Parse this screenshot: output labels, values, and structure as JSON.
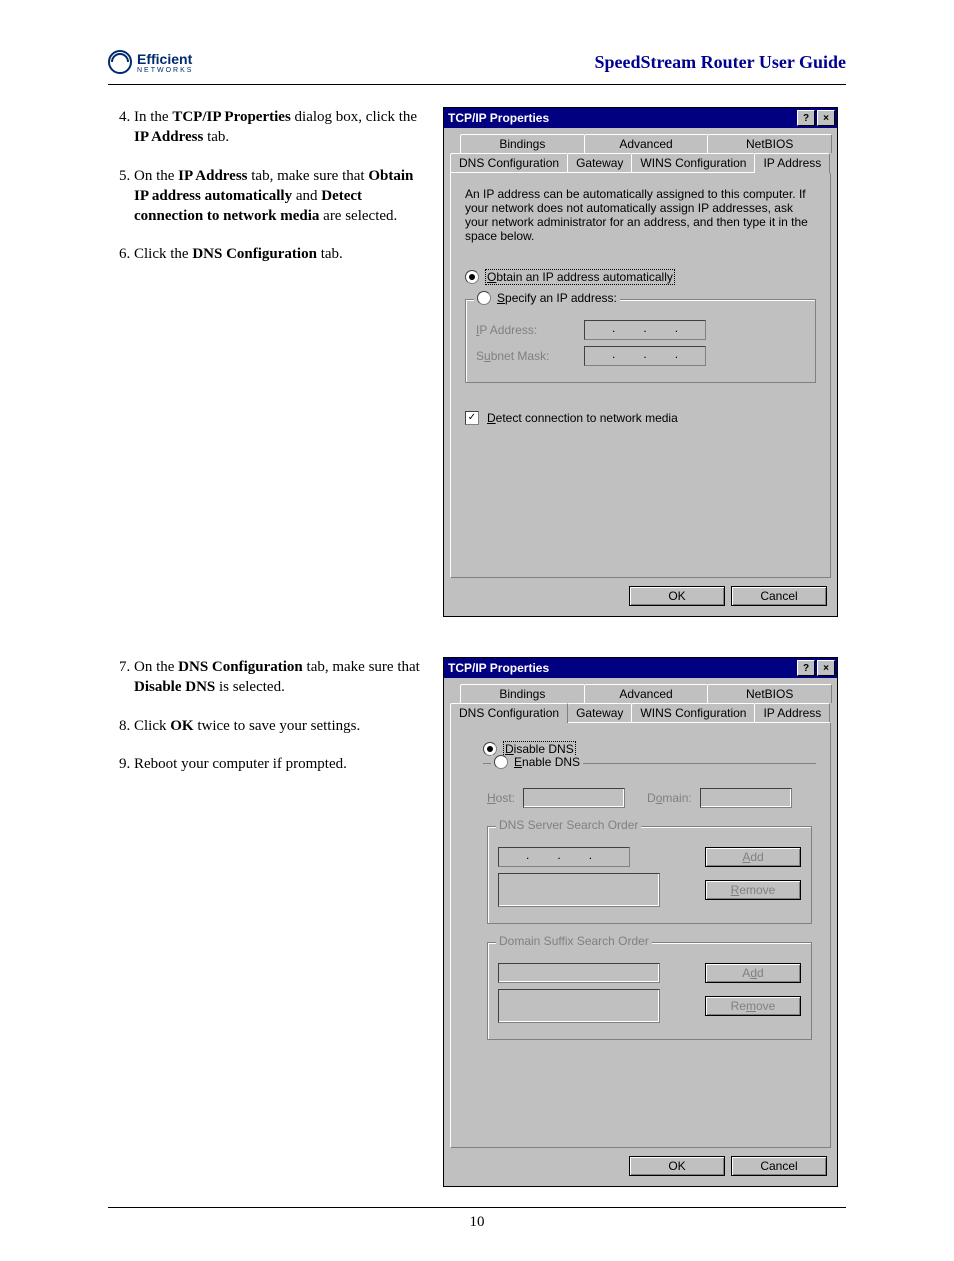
{
  "header": {
    "brand": "Efficient",
    "brand_sub": "NETWORKS",
    "guide_title": "SpeedStream Router User Guide"
  },
  "section1": {
    "steps": {
      "s4": {
        "pre": "In the ",
        "b1": "TCP/IP Properties",
        "mid": " dialog box, click the ",
        "b2": "IP Address",
        "post": " tab."
      },
      "s5": {
        "pre": "On the ",
        "b1": "IP Address",
        "mid1": " tab, make sure that ",
        "b2": "Obtain IP address automatically",
        "mid2": " and ",
        "b3": "Detect connection to network media",
        "post": " are selected."
      },
      "s6": {
        "pre": "Click the ",
        "b1": "DNS Configuration",
        "post": " tab."
      }
    },
    "dialog": {
      "title": "TCP/IP Properties",
      "tabs_back": [
        "Bindings",
        "Advanced",
        "NetBIOS"
      ],
      "tabs_front": [
        "DNS Configuration",
        "Gateway",
        "WINS Configuration",
        "IP Address"
      ],
      "active_tab": "IP Address",
      "body_text": "An IP address can be automatically assigned to this computer. If your network does not automatically assign IP addresses, ask your network administrator for an address, and then type it in the space below.",
      "radio_obtain": "Obtain an IP address automatically",
      "radio_obtain_ul": "O",
      "radio_specify": "Specify an IP address:",
      "radio_specify_ul": "S",
      "ip_label": "IP Address:",
      "ip_label_ul": "I",
      "subnet_label": "Subnet Mask:",
      "subnet_label_ul": "u",
      "detect": "Detect connection to network media",
      "detect_ul": "D",
      "ok": "OK",
      "cancel": "Cancel"
    }
  },
  "section2": {
    "steps": {
      "s7": {
        "pre": "On the ",
        "b1": "DNS Configuration",
        "mid": " tab, make sure that ",
        "b2": "Disable DNS",
        "post": " is selected."
      },
      "s8": {
        "pre": "Click ",
        "b1": "OK",
        "post": " twice to save your settings."
      },
      "s9": {
        "text": "Reboot your computer if prompted."
      }
    },
    "dialog": {
      "title": "TCP/IP Properties",
      "tabs_back": [
        "Bindings",
        "Advanced",
        "NetBIOS"
      ],
      "tabs_front": [
        "DNS Configuration",
        "Gateway",
        "WINS Configuration",
        "IP Address"
      ],
      "active_tab": "DNS Configuration",
      "radio_disable": "Disable DNS",
      "radio_disable_ul": "D",
      "radio_enable": "Enable DNS",
      "radio_enable_ul": "E",
      "host": "Host:",
      "host_ul": "H",
      "domain": "Domain:",
      "domain_ul": "o",
      "dns_order": "DNS Server Search Order",
      "add": "Add",
      "add_ul": "A",
      "remove": "Remove",
      "remove_ul": "R",
      "suffix_order": "Domain Suffix Search Order",
      "add2": "Add",
      "add2_ul": "d",
      "remove2": "Remove",
      "remove2_ul": "m",
      "ok": "OK",
      "cancel": "Cancel"
    }
  },
  "page_number": "10"
}
